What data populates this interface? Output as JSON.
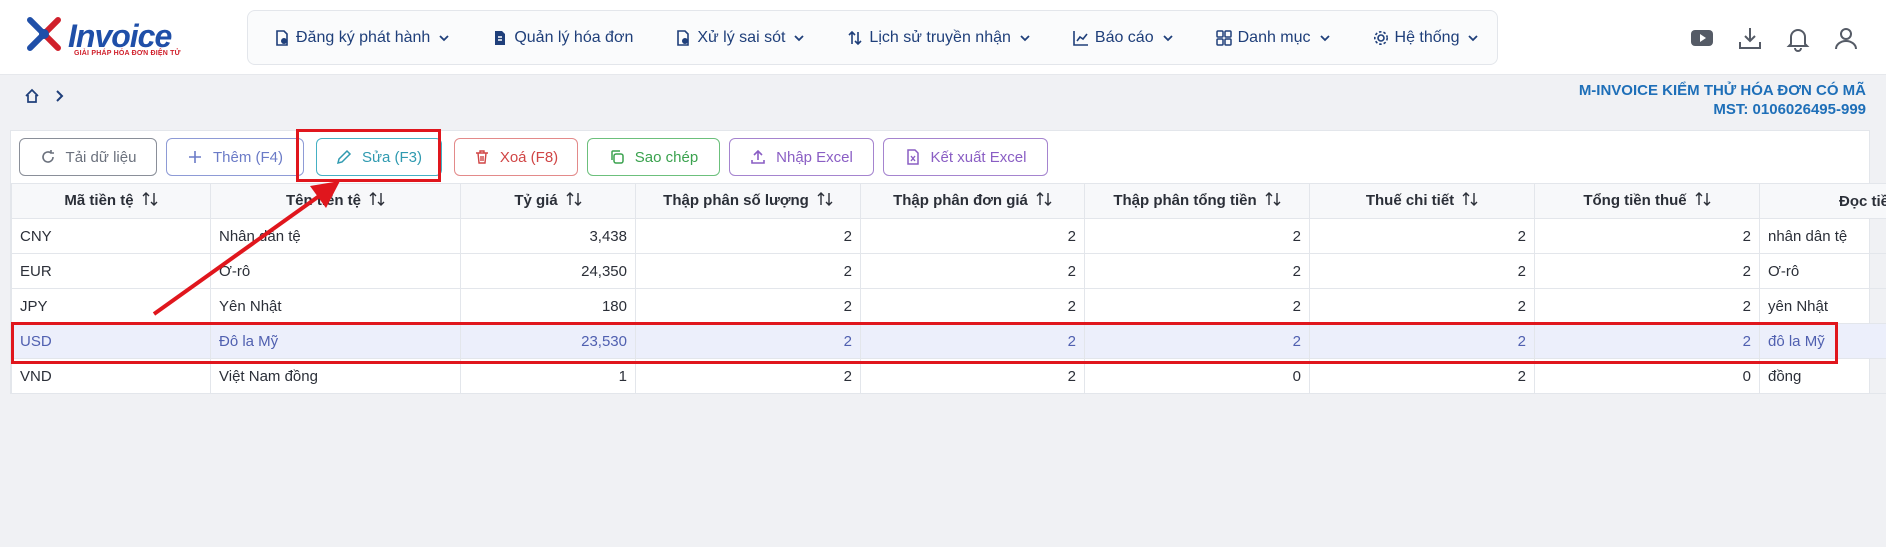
{
  "app": {
    "logo_text": "Invoice",
    "logo_sub": "GIẢI PHÁP HÓA ĐƠN ĐIỆN TỬ",
    "company_name": "M-INVOICE KIỂM THỬ HÓA ĐƠN CÓ MÃ",
    "tax_code": "MST: 0106026495-999"
  },
  "nav": [
    {
      "label": "Đăng ký phát hành",
      "icon": "file-register-icon",
      "dropdown": true
    },
    {
      "label": "Quản lý hóa đơn",
      "icon": "file-invoice-icon",
      "dropdown": false
    },
    {
      "label": "Xử lý sai sót",
      "icon": "file-error-icon",
      "dropdown": true
    },
    {
      "label": "Lịch sử truyền nhận",
      "icon": "transfer-arrows-icon",
      "dropdown": true
    },
    {
      "label": "Báo cáo",
      "icon": "chart-line-icon",
      "dropdown": true
    },
    {
      "label": "Danh mục",
      "icon": "grid-icon",
      "dropdown": true
    },
    {
      "label": "Hệ thống",
      "icon": "gear-icon",
      "dropdown": true
    }
  ],
  "top_icons": [
    "youtube-icon",
    "download-icon",
    "bell-icon",
    "user-icon"
  ],
  "toolbar": {
    "reload": "Tải dữ liệu",
    "add": "Thêm (F4)",
    "edit": "Sửa (F3)",
    "delete": "Xoá (F8)",
    "copy": "Sao chép",
    "import": "Nhập Excel",
    "export": "Kết xuất Excel"
  },
  "table": {
    "columns": [
      "Mã tiền tệ",
      "Tên tiền tệ",
      "Tỷ giá",
      "Thập phân số lượng",
      "Thập phân đơn giá",
      "Thập phân tổng tiền",
      "Thuế chi tiết",
      "Tổng tiền thuế",
      "Đọc tiề"
    ],
    "rows": [
      {
        "code": "CNY",
        "name": "Nhân dân tệ",
        "rate": "3,438",
        "qty_dec": "2",
        "price_dec": "2",
        "total_dec": "2",
        "tax_detail": "2",
        "tax_total": "2",
        "read": "nhân dân tệ",
        "selected": false
      },
      {
        "code": "EUR",
        "name": "Ơ-rô",
        "rate": "24,350",
        "qty_dec": "2",
        "price_dec": "2",
        "total_dec": "2",
        "tax_detail": "2",
        "tax_total": "2",
        "read": "Ơ-rô",
        "selected": false
      },
      {
        "code": "JPY",
        "name": "Yên Nhật",
        "rate": "180",
        "qty_dec": "2",
        "price_dec": "2",
        "total_dec": "2",
        "tax_detail": "2",
        "tax_total": "2",
        "read": "yên Nhật",
        "selected": false
      },
      {
        "code": "USD",
        "name": "Đô la Mỹ",
        "rate": "23,530",
        "qty_dec": "2",
        "price_dec": "2",
        "total_dec": "2",
        "tax_detail": "2",
        "tax_total": "2",
        "read": "đô la Mỹ",
        "selected": true
      },
      {
        "code": "VND",
        "name": "Việt Nam đồng",
        "rate": "1",
        "qty_dec": "2",
        "price_dec": "2",
        "total_dec": "0",
        "tax_detail": "2",
        "tax_total": "0",
        "read": "đồng",
        "selected": false
      }
    ]
  },
  "colors": {
    "annotation": "#e0161d",
    "brand": "#1f4fa8",
    "selected_row": "#eceffb"
  }
}
